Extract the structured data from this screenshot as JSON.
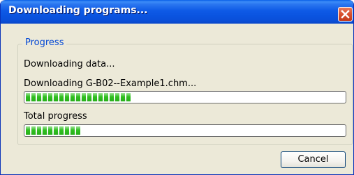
{
  "window": {
    "title": "Downloading programs..."
  },
  "progress_group": {
    "legend": "Progress",
    "status_text": "Downloading data...",
    "file_text": "Downloading G-B02--Example1.chm...",
    "file_progress": 0.33,
    "total_label": "Total progress",
    "total_progress": 0.18
  },
  "buttons": {
    "cancel_label": "Cancel"
  },
  "colors": {
    "title_bar": "#0a53df",
    "progress_fill": "#2fbf1f",
    "close_button": "#d8502e",
    "legend_text": "#0046d5"
  },
  "icons": {
    "close": "close-icon"
  }
}
